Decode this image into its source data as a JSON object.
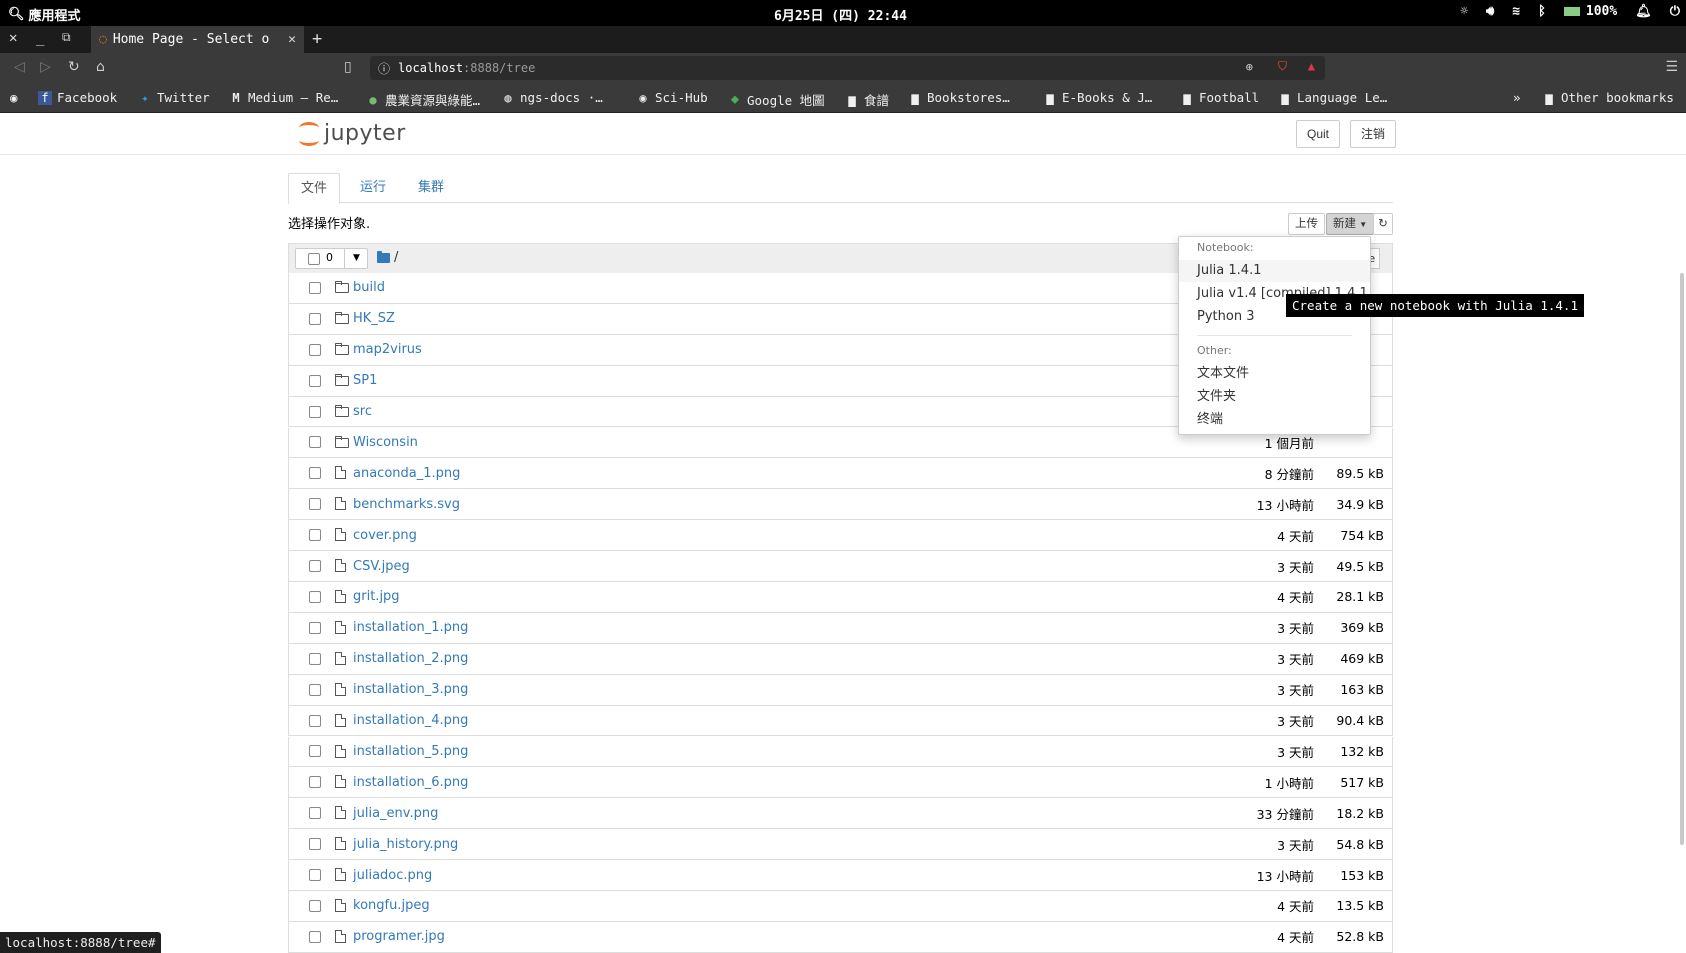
{
  "system": {
    "apps_label": "應用程式",
    "datetime": "6月25日 (四)  22:44",
    "battery": "100%"
  },
  "browser": {
    "tab_title": "Home Page - Select o",
    "url_host": "localhost",
    "url_path": ":8888/tree",
    "status_url": "localhost:8888/tree#",
    "bookmarks": [
      {
        "label": "Facebook",
        "icon": "facebook-icon"
      },
      {
        "label": "Twitter",
        "icon": "twitter-icon"
      },
      {
        "label": "Medium – Re…",
        "icon": "medium-icon"
      },
      {
        "label": "農業資源與綠能…",
        "icon": "globe-icon"
      },
      {
        "label": "ngs-docs ·…",
        "icon": "github-icon"
      },
      {
        "label": "Sci-Hub",
        "icon": "globe-icon"
      },
      {
        "label": "Google 地圖",
        "icon": "maps-icon"
      },
      {
        "label": "食譜",
        "icon": "folder-icon"
      },
      {
        "label": "Bookstores…",
        "icon": "folder-icon"
      },
      {
        "label": "E-Books & J…",
        "icon": "folder-icon"
      },
      {
        "label": "Football",
        "icon": "folder-icon"
      },
      {
        "label": "Language Le…",
        "icon": "folder-icon"
      }
    ],
    "more_bookmarks": "»",
    "other_bookmarks": "Other bookmarks"
  },
  "jupyter": {
    "logo_text": "jupyter",
    "quit_label": "Quit",
    "logout_label": "注销",
    "tabs": [
      "文件",
      "运行",
      "集群"
    ],
    "hint": "选择操作对象.",
    "upload_label": "上传",
    "new_label": "新建",
    "selected_count": "0",
    "breadcrumb": "/",
    "hidden_btn_text": "te"
  },
  "files": [
    {
      "name": "build",
      "type": "dir",
      "modified": "",
      "size": ""
    },
    {
      "name": "HK_SZ",
      "type": "dir",
      "modified": "",
      "size": ""
    },
    {
      "name": "map2virus",
      "type": "dir",
      "modified": "",
      "size": ""
    },
    {
      "name": "SP1",
      "type": "dir",
      "modified": "",
      "size": ""
    },
    {
      "name": "src",
      "type": "dir",
      "modified": "",
      "size": ""
    },
    {
      "name": "Wisconsin",
      "type": "dir",
      "modified": "1 個月前",
      "size": ""
    },
    {
      "name": "anaconda_1.png",
      "type": "file",
      "modified": "8 分鐘前",
      "size": "89.5 kB"
    },
    {
      "name": "benchmarks.svg",
      "type": "file",
      "modified": "13 小時前",
      "size": "34.9 kB"
    },
    {
      "name": "cover.png",
      "type": "file",
      "modified": "4 天前",
      "size": "754 kB"
    },
    {
      "name": "CSV.jpeg",
      "type": "file",
      "modified": "3 天前",
      "size": "49.5 kB"
    },
    {
      "name": "grit.jpg",
      "type": "file",
      "modified": "4 天前",
      "size": "28.1 kB"
    },
    {
      "name": "installation_1.png",
      "type": "file",
      "modified": "3 天前",
      "size": "369 kB"
    },
    {
      "name": "installation_2.png",
      "type": "file",
      "modified": "3 天前",
      "size": "469 kB"
    },
    {
      "name": "installation_3.png",
      "type": "file",
      "modified": "3 天前",
      "size": "163 kB"
    },
    {
      "name": "installation_4.png",
      "type": "file",
      "modified": "3 天前",
      "size": "90.4 kB"
    },
    {
      "name": "installation_5.png",
      "type": "file",
      "modified": "3 天前",
      "size": "132 kB"
    },
    {
      "name": "installation_6.png",
      "type": "file",
      "modified": "1 小時前",
      "size": "517 kB"
    },
    {
      "name": "julia_env.png",
      "type": "file",
      "modified": "33 分鐘前",
      "size": "18.2 kB"
    },
    {
      "name": "julia_history.png",
      "type": "file",
      "modified": "3 天前",
      "size": "54.8 kB"
    },
    {
      "name": "juliadoc.png",
      "type": "file",
      "modified": "13 小時前",
      "size": "153 kB"
    },
    {
      "name": "kongfu.jpeg",
      "type": "file",
      "modified": "4 天前",
      "size": "13.5 kB"
    },
    {
      "name": "programer.jpg",
      "type": "file",
      "modified": "4 天前",
      "size": "52.8 kB"
    }
  ],
  "new_menu": {
    "notebook_header": "Notebook:",
    "notebook_items": [
      "Julia 1.4.1",
      "Julia v1.4 [compiled] 1.4.1",
      "Python 3"
    ],
    "other_header": "Other:",
    "other_items": [
      "文本文件",
      "文件夹",
      "终端"
    ],
    "tooltip": "Create a new notebook with Julia 1.4.1"
  },
  "colors": {
    "link": "#337ab7",
    "jupyter_orange": "#f37726"
  }
}
